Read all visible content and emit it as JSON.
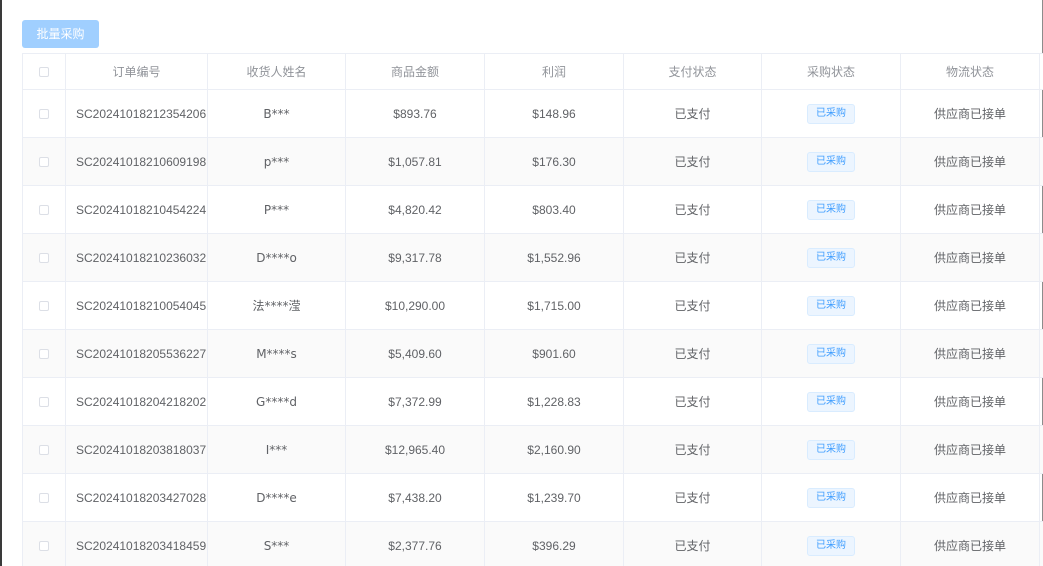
{
  "toolbar": {
    "batch_purchase_label": "批量采购"
  },
  "table": {
    "headers": {
      "order_no": "订单编号",
      "recipient": "收货人姓名",
      "amount": "商品金额",
      "profit": "利润",
      "payment_status": "支付状态",
      "purchase_status": "采购状态",
      "logistics_status": "物流状态"
    },
    "rows": [
      {
        "order_no": "SC20241018212354206",
        "recipient": "B***",
        "amount": "$893.76",
        "profit": "$148.96",
        "payment_status": "已支付",
        "purchase_status": "已采购",
        "logistics_status": "供应商已接单"
      },
      {
        "order_no": "SC20241018210609198",
        "recipient": "p***",
        "amount": "$1,057.81",
        "profit": "$176.30",
        "payment_status": "已支付",
        "purchase_status": "已采购",
        "logistics_status": "供应商已接单"
      },
      {
        "order_no": "SC20241018210454224",
        "recipient": "P***",
        "amount": "$4,820.42",
        "profit": "$803.40",
        "payment_status": "已支付",
        "purchase_status": "已采购",
        "logistics_status": "供应商已接单"
      },
      {
        "order_no": "SC20241018210236032",
        "recipient": "D****o",
        "amount": "$9,317.78",
        "profit": "$1,552.96",
        "payment_status": "已支付",
        "purchase_status": "已采购",
        "logistics_status": "供应商已接单"
      },
      {
        "order_no": "SC20241018210054045",
        "recipient": "法****滢",
        "amount": "$10,290.00",
        "profit": "$1,715.00",
        "payment_status": "已支付",
        "purchase_status": "已采购",
        "logistics_status": "供应商已接单"
      },
      {
        "order_no": "SC20241018205536227",
        "recipient": "M****s",
        "amount": "$5,409.60",
        "profit": "$901.60",
        "payment_status": "已支付",
        "purchase_status": "已采购",
        "logistics_status": "供应商已接单"
      },
      {
        "order_no": "SC20241018204218202",
        "recipient": "G****d",
        "amount": "$7,372.99",
        "profit": "$1,228.83",
        "payment_status": "已支付",
        "purchase_status": "已采购",
        "logistics_status": "供应商已接单"
      },
      {
        "order_no": "SC20241018203818037",
        "recipient": "I***",
        "amount": "$12,965.40",
        "profit": "$2,160.90",
        "payment_status": "已支付",
        "purchase_status": "已采购",
        "logistics_status": "供应商已接单"
      },
      {
        "order_no": "SC20241018203427028",
        "recipient": "D****e",
        "amount": "$7,438.20",
        "profit": "$1,239.70",
        "payment_status": "已支付",
        "purchase_status": "已采购",
        "logistics_status": "供应商已接单"
      },
      {
        "order_no": "SC20241018203418459",
        "recipient": "S***",
        "amount": "$2,377.76",
        "profit": "$396.29",
        "payment_status": "已支付",
        "purchase_status": "已采购",
        "logistics_status": "供应商已接单"
      }
    ]
  },
  "colors": {
    "primary_disabled": "#a0cfff",
    "tag_text": "#409eff",
    "tag_background": "#ecf5ff",
    "border": "#ebeef5",
    "header_text": "#909399",
    "body_text": "#606266"
  }
}
